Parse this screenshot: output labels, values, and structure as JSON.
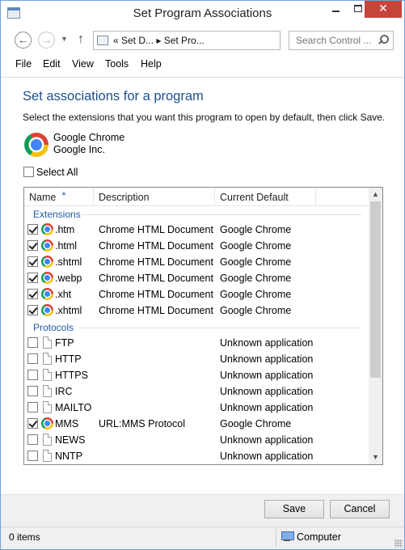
{
  "window": {
    "title": "Set Program Associations",
    "min_label": "",
    "close_label": "✕"
  },
  "nav": {
    "back": "←",
    "forward": "→",
    "dropdown": "▼",
    "up": "↑",
    "address_chevrons": "«",
    "address_path": "« Set D... ▸ Set Pro...",
    "address_expand": "›",
    "refresh": "↻",
    "search_placeholder": "Search Control ..."
  },
  "menu": {
    "file": "File",
    "edit": "Edit",
    "view": "View",
    "tools": "Tools",
    "help": "Help"
  },
  "content": {
    "heading": "Set associations for a program",
    "instructions": "Select the extensions that you want this program to open by default, then click Save.",
    "program_name": "Google Chrome",
    "program_company": "Google Inc.",
    "select_all_label": "Select All",
    "select_all_checked": false
  },
  "list": {
    "columns": {
      "name": "Name",
      "description": "Description",
      "current_default": "Current Default"
    },
    "sort_indicator": "▲",
    "groups": {
      "extensions": "Extensions",
      "protocols": "Protocols"
    },
    "extensions": [
      {
        "name": ".htm",
        "description": "Chrome HTML Document",
        "default": "Google Chrome",
        "checked": true,
        "icon": "chrome-icon"
      },
      {
        "name": ".html",
        "description": "Chrome HTML Document",
        "default": "Google Chrome",
        "checked": true,
        "icon": "chrome-icon"
      },
      {
        "name": ".shtml",
        "description": "Chrome HTML Document",
        "default": "Google Chrome",
        "checked": true,
        "icon": "chrome-icon"
      },
      {
        "name": ".webp",
        "description": "Chrome HTML Document",
        "default": "Google Chrome",
        "checked": true,
        "icon": "chrome-icon"
      },
      {
        "name": ".xht",
        "description": "Chrome HTML Document",
        "default": "Google Chrome",
        "checked": true,
        "icon": "chrome-icon"
      },
      {
        "name": ".xhtml",
        "description": "Chrome HTML Document",
        "default": "Google Chrome",
        "checked": true,
        "icon": "chrome-icon"
      }
    ],
    "protocols": [
      {
        "name": "FTP",
        "description": "",
        "default": "Unknown application",
        "checked": false,
        "icon": "file-icon"
      },
      {
        "name": "HTTP",
        "description": "",
        "default": "Unknown application",
        "checked": false,
        "icon": "file-icon"
      },
      {
        "name": "HTTPS",
        "description": "",
        "default": "Unknown application",
        "checked": false,
        "icon": "file-icon"
      },
      {
        "name": "IRC",
        "description": "",
        "default": "Unknown application",
        "checked": false,
        "icon": "file-icon"
      },
      {
        "name": "MAILTO",
        "description": "",
        "default": "Unknown application",
        "checked": false,
        "icon": "file-icon"
      },
      {
        "name": "MMS",
        "description": "URL:MMS Protocol",
        "default": "Google Chrome",
        "checked": true,
        "icon": "chrome-icon"
      },
      {
        "name": "NEWS",
        "description": "",
        "default": "Unknown application",
        "checked": false,
        "icon": "file-icon"
      },
      {
        "name": "NNTP",
        "description": "",
        "default": "Unknown application",
        "checked": false,
        "icon": "file-icon"
      }
    ],
    "scroll_up": "▲",
    "scroll_down": "▼"
  },
  "buttons": {
    "save": "Save",
    "cancel": "Cancel"
  },
  "status": {
    "items": "0 items",
    "location": "Computer"
  },
  "colors": {
    "heading": "#1e4f8c",
    "group": "#1e5aa3",
    "close_button": "#c7443a"
  }
}
